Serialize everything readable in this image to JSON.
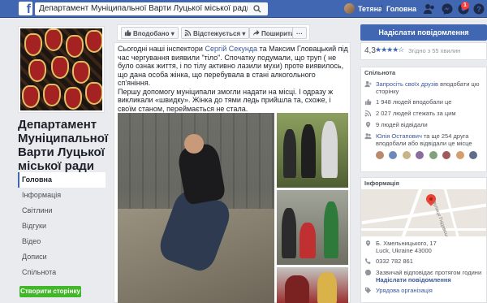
{
  "topbar": {
    "logo": "f",
    "search_value": "Департамент Муніципальної Варти Луцької міської ради",
    "user_name": "Тетяна",
    "home_label": "Головна",
    "notifications_count": "1"
  },
  "left": {
    "page_name": "Департамент Муніципальної Варти Луцької міської ради",
    "nav": [
      "Головна",
      "Інформація",
      "Світлини",
      "Відгуки",
      "Відео",
      "Дописи",
      "Спільнота"
    ],
    "create_page": "Створити сторінку"
  },
  "actions": {
    "like": "Вподобано",
    "follow": "Відстежується",
    "share": "Поширити",
    "more": "···"
  },
  "post": {
    "text_before": "Сьогодні наші інспектори ",
    "link1": "Сергій Секунда",
    "text_mid": " та Максим Гловацький під час чергування виявили \"тіло\". Спочатку подумали, що труп ( не було ознак життя, і по тілу активно лазили мухи) проте виявилось, що дана особа жінка, що перебувала в стані алкогольного сп'яніння.",
    "text_p2": "Першу допомогу муніципали змогли надати на місці. І одразу ж викликали «швидку». Жінка до тями ледь прийшла та, схоже, і своїм станом, переймається не стала."
  },
  "right": {
    "send_message": "Надіслати повідомлення",
    "rating_value": "4,3",
    "stars": "★★★★☆",
    "rating_sub": "Згідно з 55 хвилин",
    "community_header": "Спільнота",
    "invite_link": "Запросіть своїх друзів",
    "invite_text": " вподобати цю сторінку",
    "likes": "1 948 людей вподобали це",
    "follows": "2 027 людей стежать за цим",
    "visited": "9 людей відвідали",
    "friends_name": "Юлія Остапович",
    "friends_text": " та ще 254 друга вподобали або відвідали це місце",
    "info_header": "Інформація",
    "street_label": "вулиця Гнідавська",
    "address": "Б. Хмельницького, 17",
    "address_city": "Luck, Ukraine 43000",
    "phone": "0332 782 861",
    "response": "Зазвичай відповідає протягом години",
    "send_link": "Надіслати повідомлення",
    "org_type": "Урядова організація"
  }
}
